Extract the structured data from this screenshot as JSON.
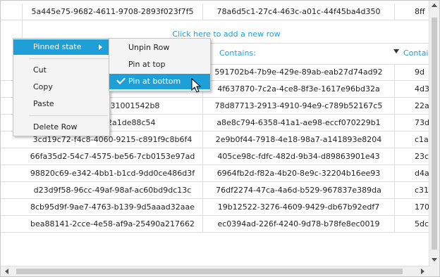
{
  "grid": {
    "pinned_row": {
      "c1": "5a445e75-9682-4611-9708-2893f023f7f5",
      "c2": "78a6d5c1-27c4-463c-a01c-44f45ba4d350",
      "c3": "8ff"
    },
    "new_row_text": "Click here to add a new row",
    "filter": {
      "col2_label": "Contains:",
      "col3_label": "Contai"
    },
    "rows": [
      {
        "c1": "",
        "c2": "591702b4-7b9e-429e-89ab-eab27d74ad92",
        "c3": "9d"
      },
      {
        "c1": "ae4-9b96-7985fa333fc8",
        "c2": "4f637870-7c2a-4ce8-8f3e-1617e96bd32a",
        "c3": "4d3"
      },
      {
        "c1": "19-b037-9931001542b8",
        "c2": "78d87713-2913-4910-94e9-c789b52167c5",
        "c3": "22a"
      },
      {
        "c1": "1-acc0-ec2a1de88c54",
        "c2": "a8e8c794-6358-41a1-ae98-eccf070229b1",
        "c3": "73d"
      },
      {
        "c1": "3cd19c72-f4c8-4060-9215-c891f9c8b6f4",
        "c2": "2e9b0f44-7918-4e18-98a7-a141893e8204",
        "c3": "c1a"
      },
      {
        "c1": "66fa35d2-54c7-4575-be56-7cb0153e97ad",
        "c2": "405ce98c-fdfc-482d-9b34-d89863901e43",
        "c3": "23c"
      },
      {
        "c1": "98820c69-e342-4bb1-b1cd-9dd0ce486d3f",
        "c2": "6964fb2d-f82a-4b20-8e9c-32204b16ee93",
        "c3": "d4a"
      },
      {
        "c1": "d23d9f58-96cc-49af-98af-ac60bd9dc13c",
        "c2": "76df2274-47ca-4a6d-b529-967837e389da",
        "c3": "c31"
      },
      {
        "c1": "8cb95d9f-9ae7-4763-b139-9d5aaad32aae",
        "c2": "19b12522-3276-4609-9429-db67b92edf7",
        "c3": "170"
      },
      {
        "c1": "bea88141-2cce-4e58-af9a-25490a217662",
        "c2": "ec0394ad-226f-4240-9d78-b78fe8ec0019",
        "c3": "5dc"
      }
    ]
  },
  "context_menu": {
    "items": [
      {
        "label": "Pinned state",
        "active": true,
        "has_submenu": true
      },
      {
        "label": "Cut"
      },
      {
        "label": "Copy"
      },
      {
        "label": "Paste"
      },
      {
        "label": "Delete Row"
      }
    ]
  },
  "submenu": {
    "items": [
      {
        "label": "Unpin Row"
      },
      {
        "label": "Pin at top"
      },
      {
        "label": "Pin at bottom",
        "checked": true,
        "active": true
      }
    ]
  },
  "colors": {
    "accent": "#1e9fd8",
    "menu_bg": "#f4f4f4",
    "grid_line": "#dcdcdc"
  }
}
